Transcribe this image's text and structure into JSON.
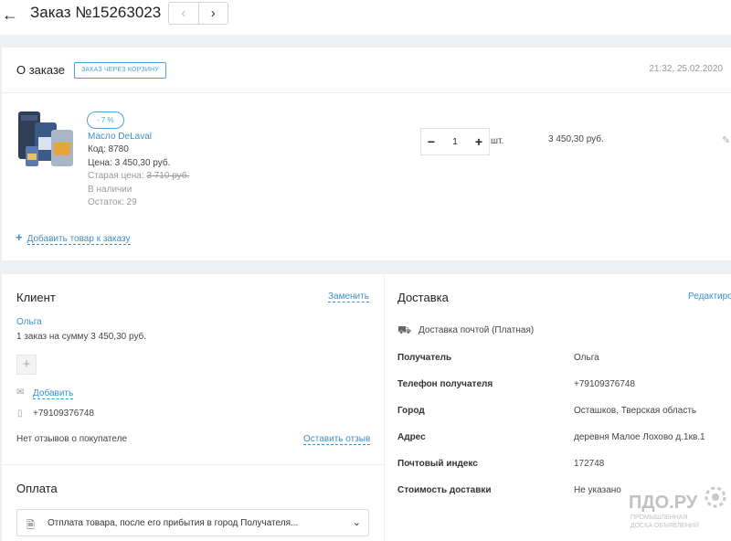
{
  "header": {
    "back_icon": "arrow-left-icon",
    "title": "Заказ №15263023",
    "prev_icon": "chevron-left-icon",
    "next_icon": "chevron-right-icon"
  },
  "order": {
    "section_title": "О заказе",
    "source_badge": "Заказ через корзину",
    "datetime": "21:32, 25.02.2020",
    "item": {
      "discount": "- 7 %",
      "name": "Масло DeLaval",
      "code": "Код: 8780",
      "price": "Цена: 3 450,30 руб.",
      "old_price_label": "Старая цена: ",
      "old_price_value": "3 710 руб.",
      "stock_status": "В наличии",
      "remaining": "Остаток: 29",
      "qty_minus": "−",
      "qty_value": "1",
      "qty_plus": "+",
      "unit": "шт.",
      "total": "3 450,30 руб."
    },
    "add_product_plus": "+",
    "add_product_label": "Добавить товар к заказу"
  },
  "client": {
    "section_title": "Клиент",
    "change_label": "Заменить",
    "name": "Ольга",
    "orders_summary": "1 заказ на сумму 3 450,30 руб.",
    "add_email_label": "Добавить",
    "phone": "+79109376748",
    "no_reviews": "Нет отзывов о покупателе",
    "leave_review": "Оставить отзыв"
  },
  "delivery": {
    "section_title": "Доставка",
    "edit_label": "Редактировать",
    "type": "Доставка почтой (Платная)",
    "rows": [
      {
        "label": "Получатель",
        "value": "Ольга"
      },
      {
        "label": "Телефон получателя",
        "value": "+79109376748"
      },
      {
        "label": "Город",
        "value": "Осташков, Тверская область"
      },
      {
        "label": "Адрес",
        "value": "деревня Малое Лохово д.1кв.1"
      },
      {
        "label": "Почтовый индекс",
        "value": "172748"
      },
      {
        "label": "Стоимость доставки",
        "value": "Не указано"
      }
    ]
  },
  "payment": {
    "section_title": "Оплата",
    "selected": "Отплата товара, после его прибытия в город Получателя..."
  },
  "watermark": {
    "main": "ПДО.РУ",
    "sub1": "ПРОМЫШЛЕННАЯ",
    "sub2": "ДОСКА ОБЪЯВЛЕНИЙ"
  },
  "colors": {
    "accent": "#3d8fc9",
    "badge": "#4ba3d3",
    "background": "#eeeff1"
  }
}
